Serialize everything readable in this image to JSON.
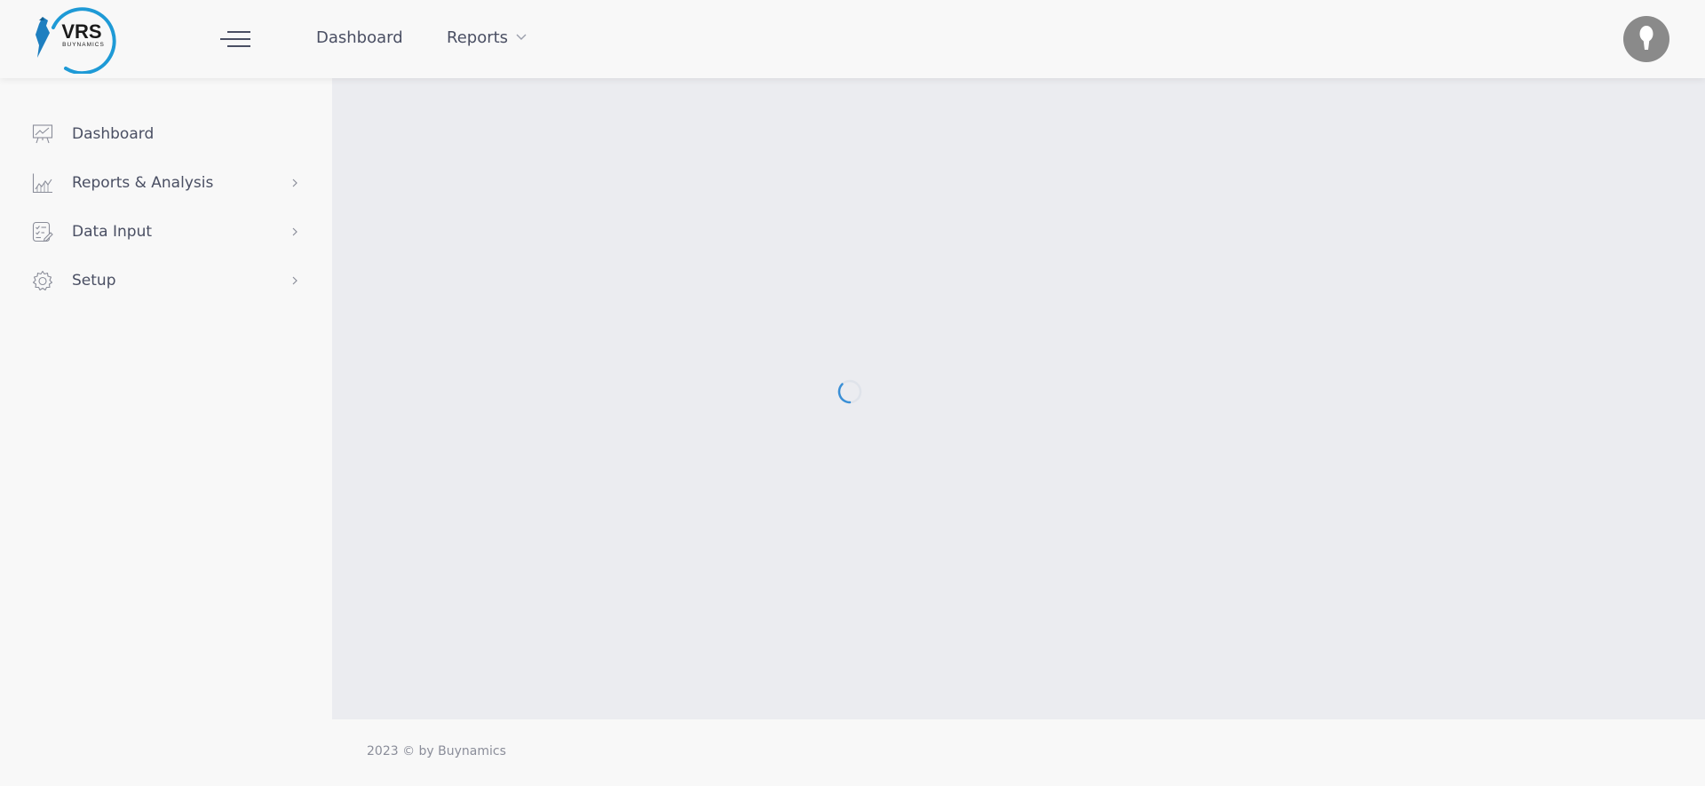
{
  "app": {
    "logo_text": "VRS",
    "logo_subtext": "BUYNAMICS"
  },
  "header": {
    "nav": [
      {
        "label": "Dashboard"
      },
      {
        "label": "Reports",
        "has_dropdown": true
      }
    ],
    "icons": {
      "menu": "hamburger-icon",
      "avatar": "user-avatar",
      "dropdown": "chevron-down-icon"
    }
  },
  "sidebar": {
    "items": [
      {
        "label": "Dashboard",
        "icon": "presentation-chart-icon",
        "has_submenu": false
      },
      {
        "label": "Reports & Analysis",
        "icon": "area-chart-icon",
        "has_submenu": true
      },
      {
        "label": "Data Input",
        "icon": "checklist-edit-icon",
        "has_submenu": true
      },
      {
        "label": "Setup",
        "icon": "gear-icon",
        "has_submenu": true
      }
    ]
  },
  "main": {
    "state": "loading",
    "spinner_color": "#3a8fd6"
  },
  "footer": {
    "text": "2023 © by Buynamics"
  },
  "colors": {
    "brand_blue": "#1e9ad6",
    "text": "#4a4f63",
    "content_bg": "#ebecf0"
  }
}
